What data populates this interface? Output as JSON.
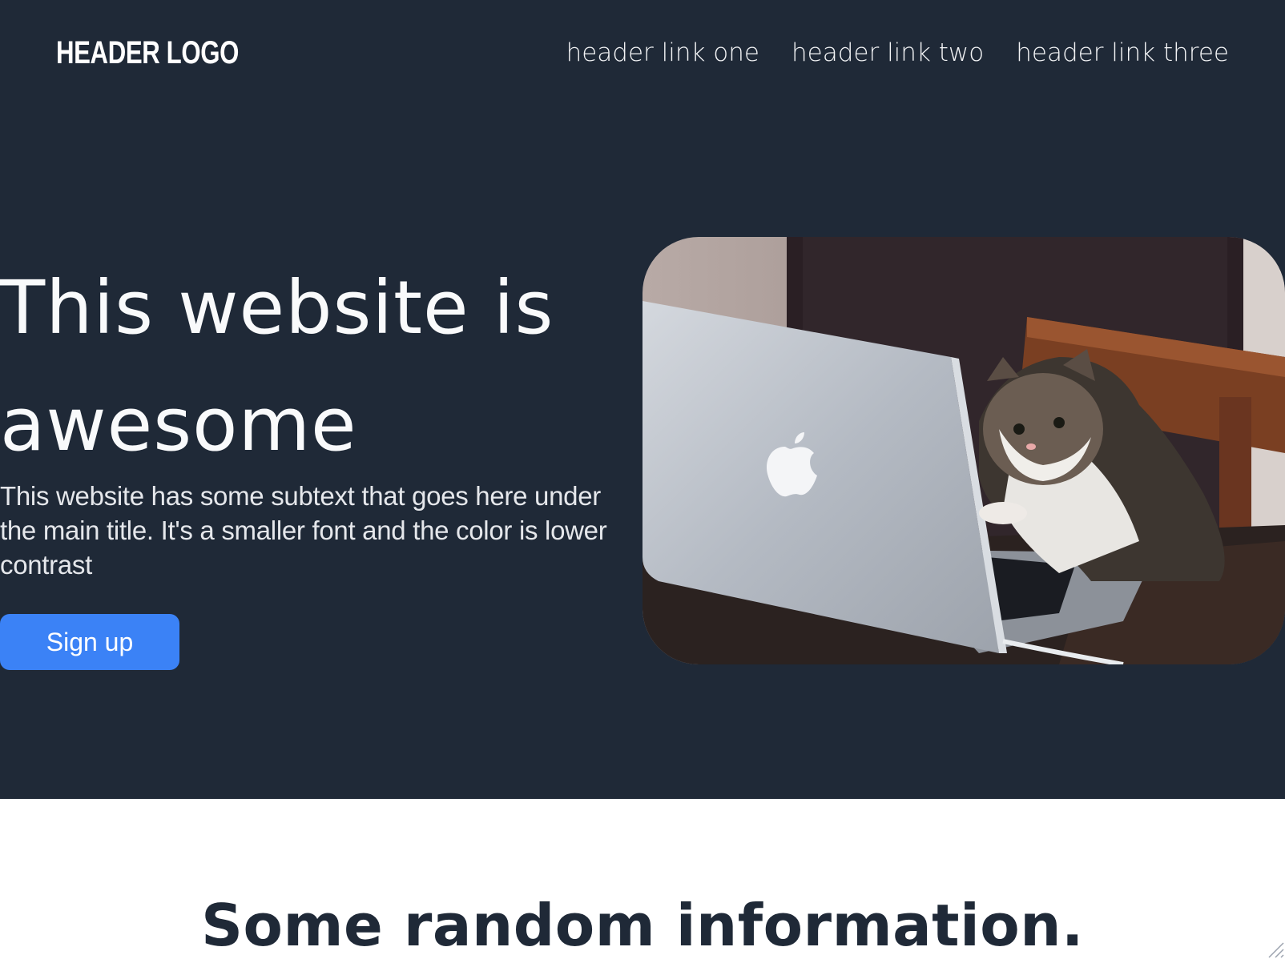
{
  "header": {
    "logo": "HEADER LOGO",
    "links": [
      "header link one",
      "header link two",
      "header link three"
    ]
  },
  "hero": {
    "title": "This website is awesome",
    "subtext": "This website has some subtext that goes here under the main title. It's a smaller font and the color is lower contrast",
    "cta_label": "Sign up",
    "image_icon": "photo-cat-at-laptop"
  },
  "info": {
    "title": "Some random information."
  },
  "colors": {
    "hero_background": "#1f2937",
    "accent": "#3b82f6",
    "page_background": "#ffffff",
    "info_title": "#1f2937"
  }
}
